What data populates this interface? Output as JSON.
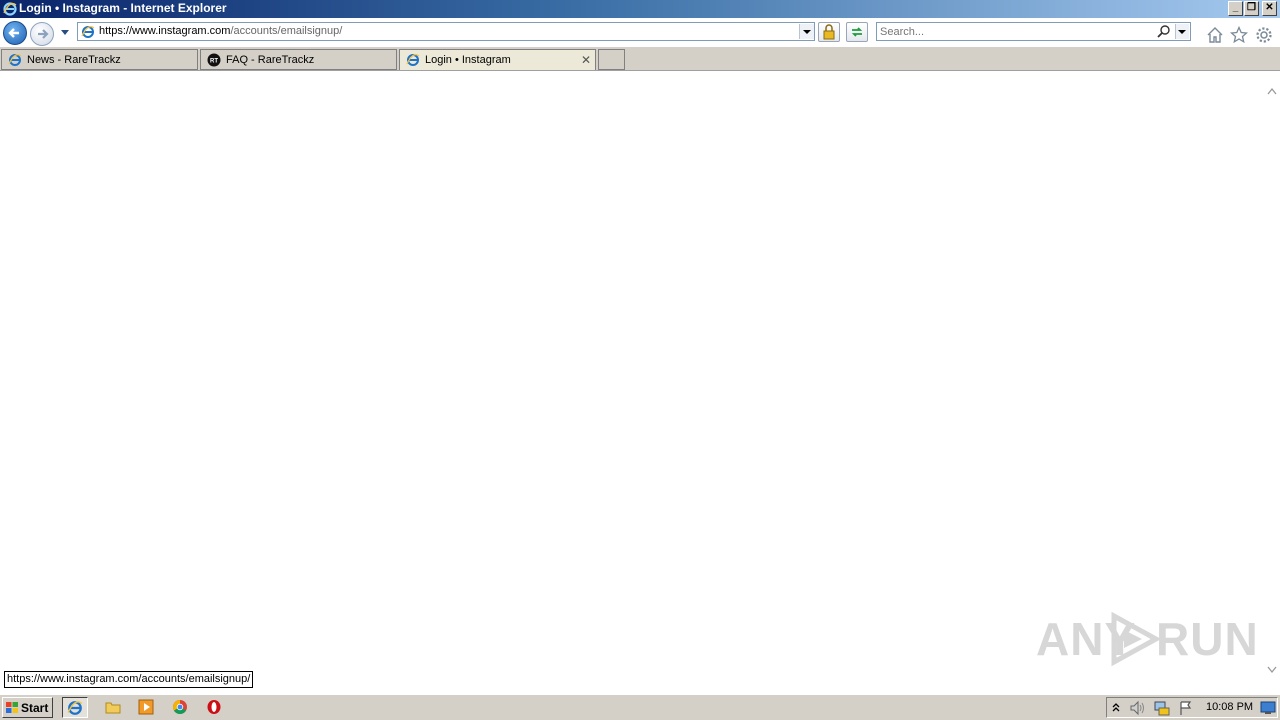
{
  "window": {
    "title": "Login • Instagram - Internet Explorer",
    "minimize": "_",
    "restore": "❐",
    "close": "✕"
  },
  "nav": {
    "address_prefix": "https://www.",
    "address_domain": "instagram.com",
    "address_path": "/accounts/emailsignup/",
    "search_placeholder": "Search..."
  },
  "tabs": [
    {
      "label": "News - RareTrackz"
    },
    {
      "label": "FAQ - RareTrackz"
    },
    {
      "label": "Login • Instagram",
      "close": "✕"
    }
  ],
  "status_url": "https://www.instagram.com/accounts/emailsignup/",
  "watermark": {
    "left": "ANY",
    "right": "RUN"
  },
  "taskbar": {
    "start": "Start",
    "clock": "10:08 PM"
  },
  "colors": {
    "title_start": "#0a246a",
    "title_end": "#a6caf0",
    "chrome": "#d4d0c8",
    "ie_blue": "#1e73c8"
  }
}
